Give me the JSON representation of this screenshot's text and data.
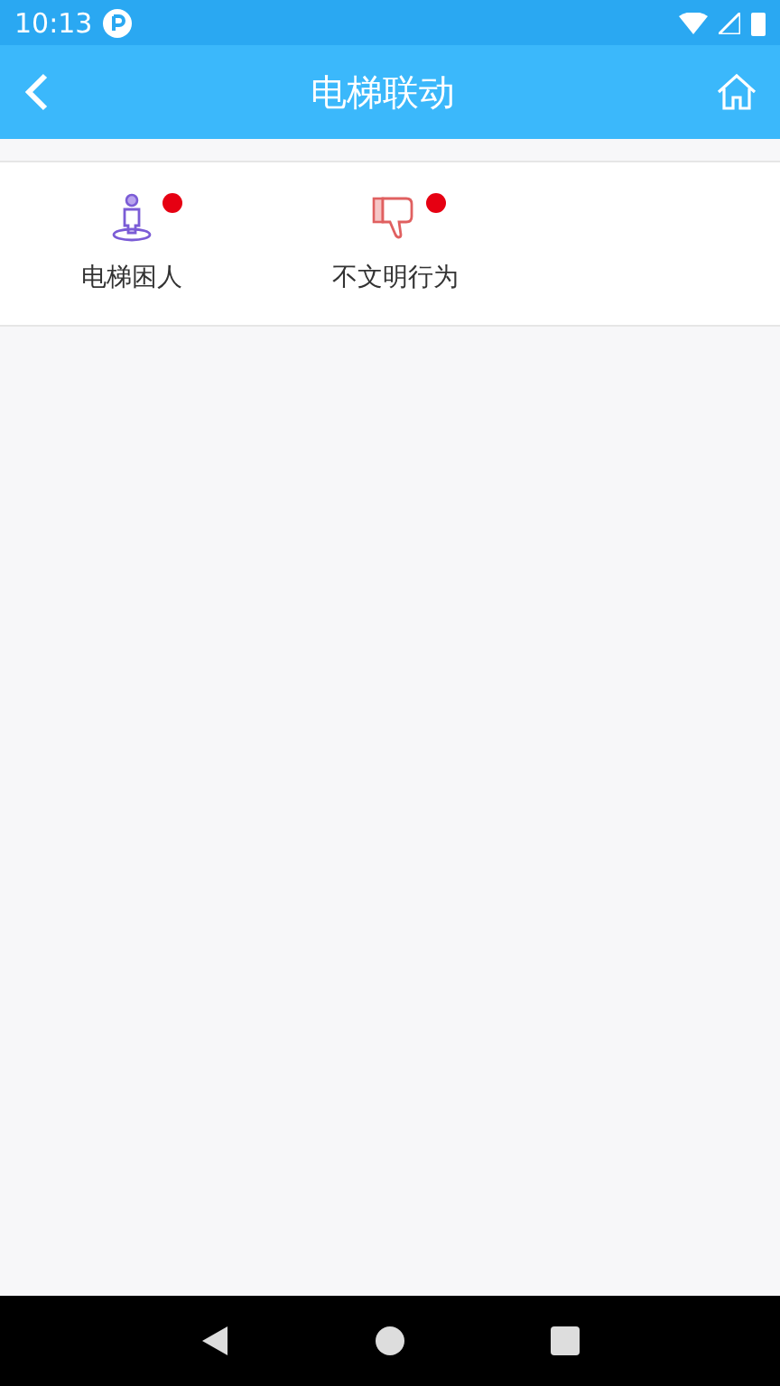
{
  "status_bar": {
    "time": "10:13"
  },
  "header": {
    "title": "电梯联动"
  },
  "items": [
    {
      "label": "电梯困人",
      "kind": "person",
      "badge": true
    },
    {
      "label": "不文明行为",
      "kind": "thumbs-down",
      "badge": true
    }
  ]
}
